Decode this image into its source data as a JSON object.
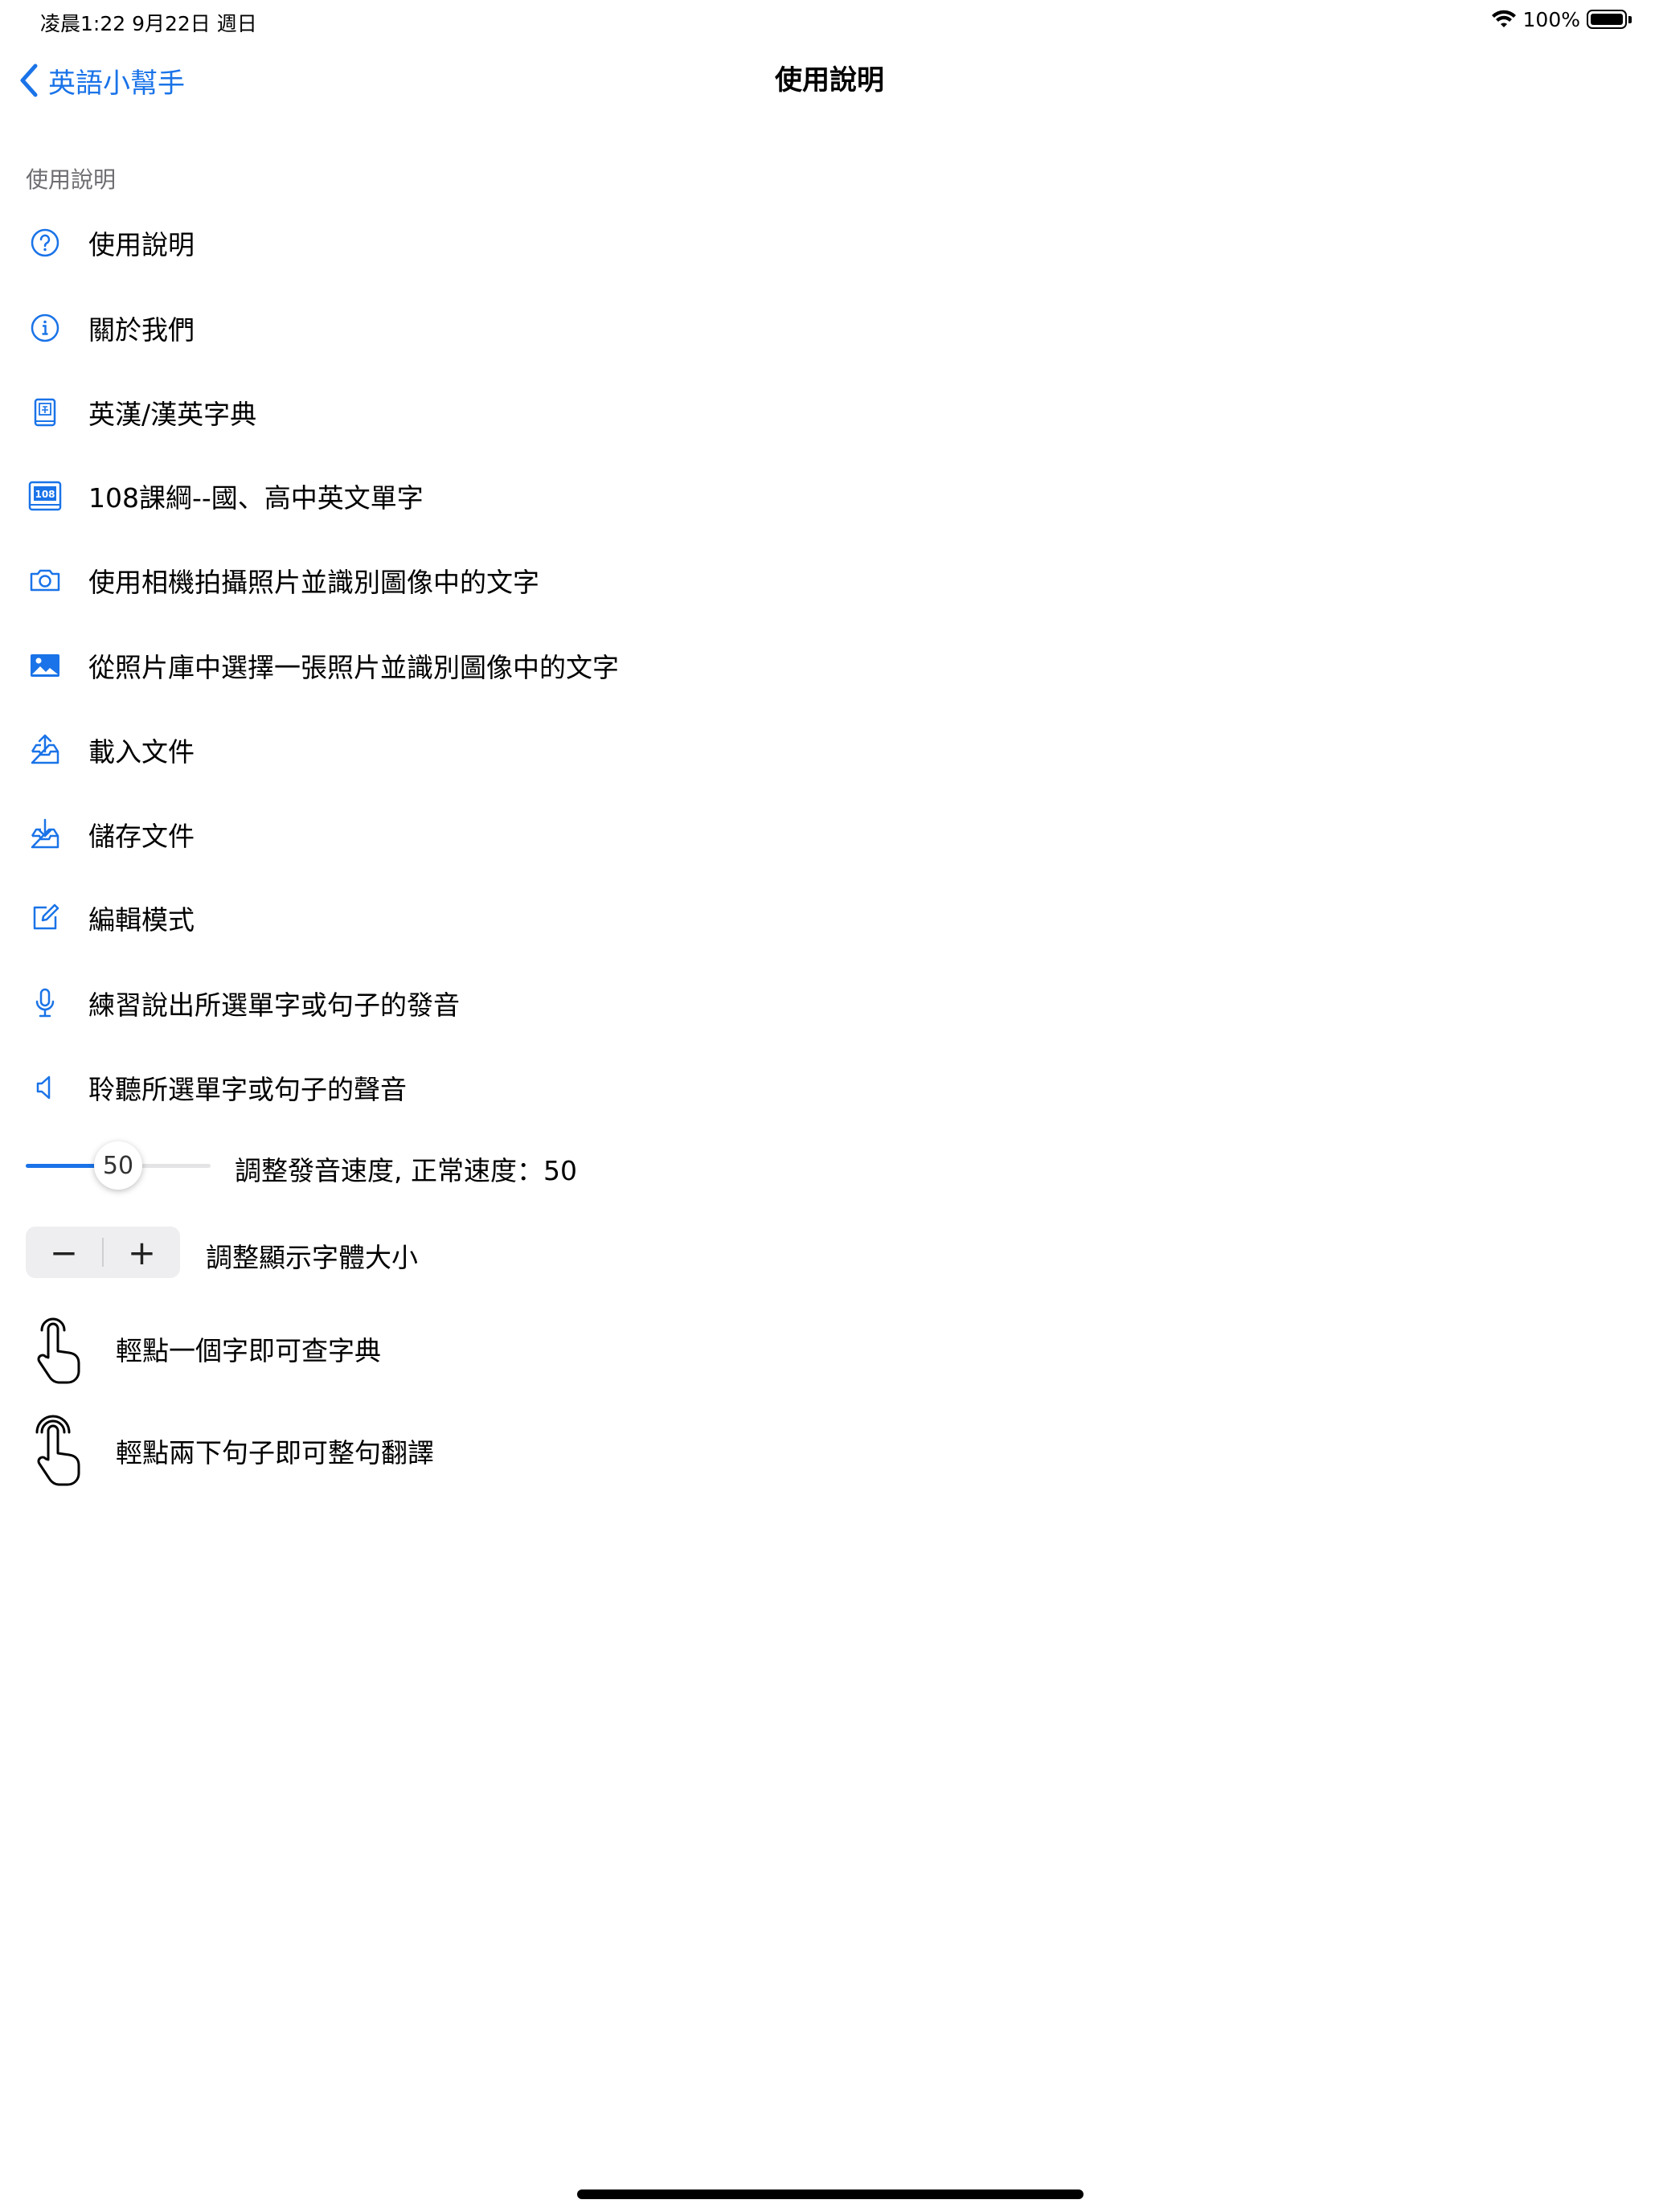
{
  "status_bar": {
    "time": "凌晨1:22   9月22日 週日",
    "battery": "100%"
  },
  "nav": {
    "back_label": "英語小幫手",
    "title": "使用說明"
  },
  "section": {
    "header": "使用說明"
  },
  "items": [
    {
      "label": "使用說明",
      "icon": "question-circle-icon"
    },
    {
      "label": "關於我們",
      "icon": "info-circle-icon"
    },
    {
      "label": "英漢/漢英字典",
      "icon": "dictionary-book-icon"
    },
    {
      "label": "108課綱--國、高中英文單字",
      "icon": "book-108-icon"
    },
    {
      "label": "使用相機拍攝照片並識別圖像中的文字",
      "icon": "camera-icon"
    },
    {
      "label": "從照片庫中選擇一張照片並識別圖像中的文字",
      "icon": "photo-icon"
    },
    {
      "label": "載入文件",
      "icon": "tray-upload-icon"
    },
    {
      "label": "儲存文件",
      "icon": "tray-download-icon"
    },
    {
      "label": "編輯模式",
      "icon": "edit-square-icon"
    },
    {
      "label": "練習說出所選單字或句子的發音",
      "icon": "microphone-icon"
    },
    {
      "label": "聆聽所選單字或句子的聲音",
      "icon": "speaker-icon"
    }
  ],
  "slider": {
    "value": "50",
    "fraction": 0.5,
    "label": "調整發音速度, 正常速度：50"
  },
  "stepper": {
    "minus": "−",
    "plus": "+",
    "label": "調整顯示字體大小"
  },
  "gestures": [
    {
      "label": "輕點一個字即可查字典",
      "icon": "single-tap-hand-icon"
    },
    {
      "label": "輕點兩下句子即可整句翻譯",
      "icon": "double-tap-hand-icon"
    }
  ],
  "colors": {
    "accent": "#1a73e8",
    "secondary_text": "#6d6d72"
  }
}
